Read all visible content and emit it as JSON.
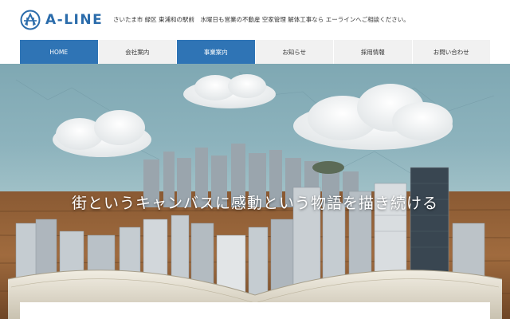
{
  "brand": {
    "name": "A-LINE",
    "color": "#2b6cab"
  },
  "header": {
    "tagline": "さいたま市 緑区 東浦和の駅前　水曜日も営業の不動産 空家管理 解体工事なら エーラインへご相談ください。"
  },
  "nav": {
    "items": [
      {
        "label": "HOME",
        "active": true
      },
      {
        "label": "会社案内",
        "active": false
      },
      {
        "label": "事業案内",
        "active": true
      },
      {
        "label": "お知らせ",
        "active": false
      },
      {
        "label": "採用情報",
        "active": false
      },
      {
        "label": "お問い合わせ",
        "active": false
      }
    ],
    "active_color": "#2f74b5",
    "inactive_color": "#f1f1f1"
  },
  "hero": {
    "caption": "街というキャンバスに感動という物語を描き続ける"
  },
  "icons": {
    "logo": "a-line-logo-icon"
  }
}
